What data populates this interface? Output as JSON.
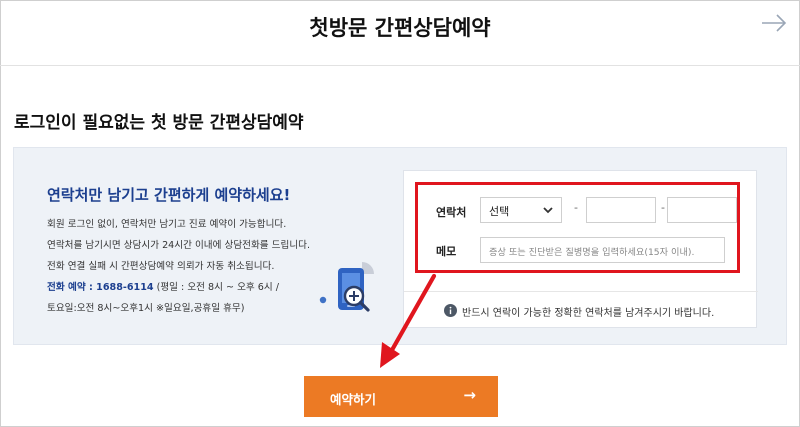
{
  "header": {
    "title": "첫방문 간편상담예약",
    "next_icon": "right-arrow-icon"
  },
  "section": {
    "title": "로그인이 필요없는 첫 방문 간편상담예약"
  },
  "intro": {
    "headline": "연락처만 남기고 간편하게 예약하세요!",
    "lines": [
      "회원 로그인 없이, 연락처만 남기고 진료 예약이 가능합니다.",
      "연락처를 남기시면 상담시가 24시간 이내에 상담전화를 드립니다.",
      "전화 연결 실패 시 간편상담예약 의뢰가 자동 취소됩니다."
    ],
    "phone_label": "전화 예약 : 1688-6114",
    "phone_hours": " (평일 : 오전 8시 ~ 오후 6시 /",
    "weekend": "토요일:오전 8시~오후1시 ※일요일,공휴일 휴무)"
  },
  "form": {
    "contact_label": "연락처",
    "contact_select": "선택",
    "dash": "-",
    "memo_label": "메모",
    "memo_placeholder": "증상 또는 진단받은 질병명을 입력하세요(15자 이내).",
    "notice": "반드시 연락이 가능한 정확한 연락처를 남겨주시기 바랍니다."
  },
  "action": {
    "reserve_label": "예약하기",
    "reserve_arrow": "→"
  },
  "colors": {
    "accent_blue": "#1c3f8f",
    "highlight_red": "#e0161e",
    "button_orange": "#ec7a24",
    "panel_bg": "#eef2f7"
  }
}
